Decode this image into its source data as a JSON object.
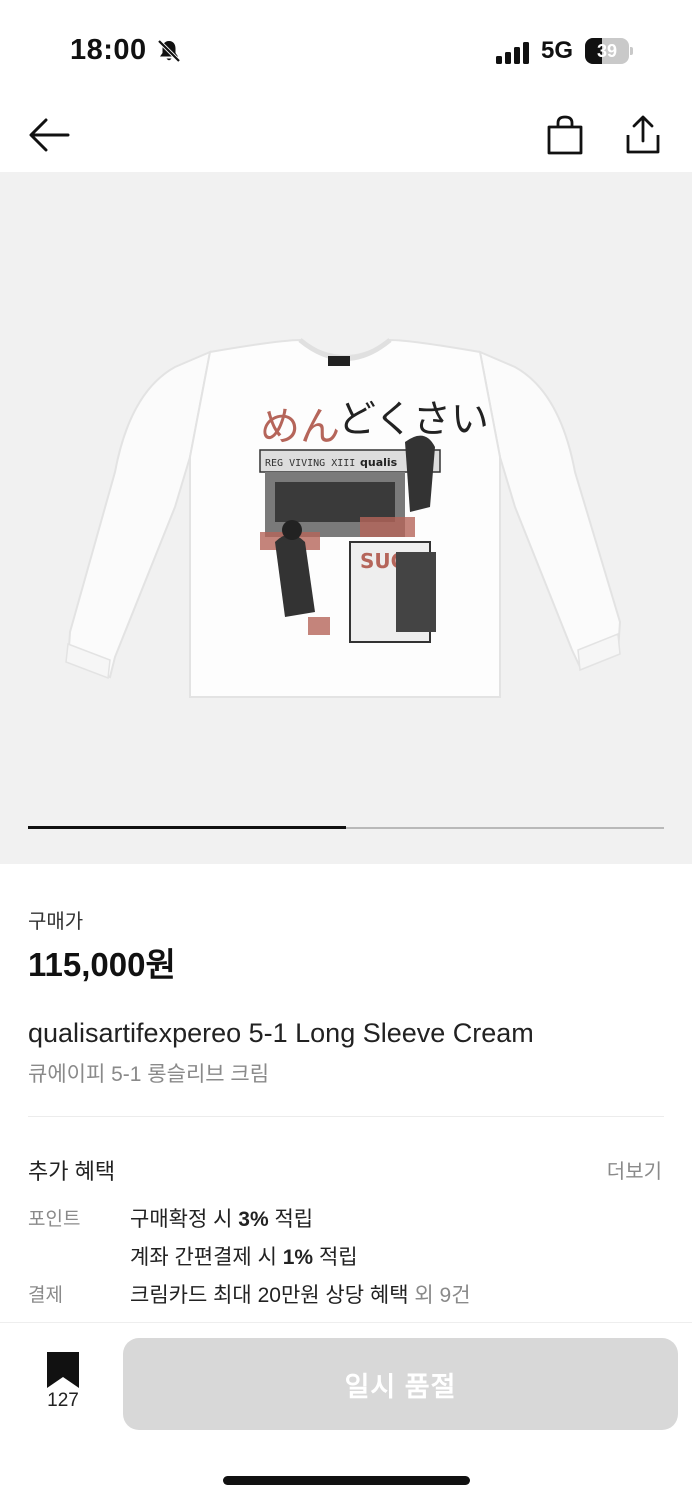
{
  "status_bar": {
    "time": "18:00",
    "network": "5G",
    "battery": "39",
    "battery_level": 0.39
  },
  "nav": {
    "back_icon": "arrow-left-icon",
    "cart_icon": "shopping-bag-icon",
    "share_icon": "share-icon"
  },
  "gallery": {
    "progress": 0.5
  },
  "product": {
    "price_label": "구매가",
    "price": "115,000원",
    "title_en": "qualisartifexpereo 5-1 Long Sleeve Cream",
    "title_ko": "큐에이피 5-1 롱슬리브 크림"
  },
  "print": {
    "kana": "めんどくさい",
    "banner": "REG VIVING XIII",
    "side_text": "SUCK",
    "brand": "qualis"
  },
  "benefits": {
    "title": "추가 혜택",
    "more": "더보기",
    "point_label": "포인트",
    "point_1_pre": "구매확정 시 ",
    "point_1_bold": "3%",
    "point_1_post": " 적립",
    "point_2_pre": "계좌 간편결제 시 ",
    "point_2_bold": "1%",
    "point_2_post": " 적립",
    "pay_label": "결제",
    "pay_text": "크림카드 최대 20만원 상당 혜택",
    "pay_extra": " 외 9건"
  },
  "bottom": {
    "bookmark_count": "127",
    "cta": "일시 품절"
  },
  "colors": {
    "accent": "#111111",
    "cta_disabled": "#d8d8d8",
    "print_red": "#b5655a"
  }
}
